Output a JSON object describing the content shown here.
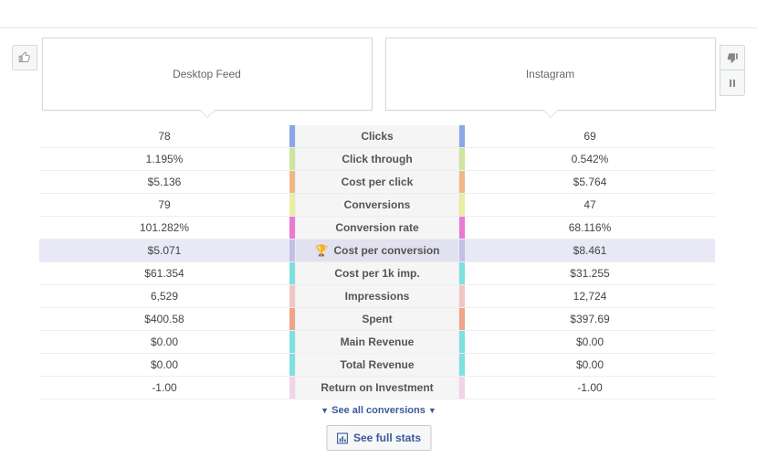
{
  "panels": {
    "left": "Desktop Feed",
    "right": "Instagram"
  },
  "rows": [
    {
      "label": "Clicks",
      "left": "78",
      "right": "69",
      "colorL": "#8aa6e6",
      "colorR": "#8aa6e6"
    },
    {
      "label": "Click through",
      "left": "1.195%",
      "right": "0.542%",
      "colorL": "#cde59c",
      "colorR": "#cde59c"
    },
    {
      "label": "Cost per click",
      "left": "$5.136",
      "right": "$5.764",
      "colorL": "#f0b785",
      "colorR": "#f0b785"
    },
    {
      "label": "Conversions",
      "left": "79",
      "right": "47",
      "colorL": "#e6f0a0",
      "colorR": "#e6f0a0"
    },
    {
      "label": "Conversion rate",
      "left": "101.282%",
      "right": "68.116%",
      "colorL": "#e87ad1",
      "colorR": "#e87ad1"
    },
    {
      "label": "Cost per conversion",
      "left": "$5.071",
      "right": "$8.461",
      "colorL": "#c3bfe6",
      "colorR": "#c3bfe6",
      "highlight": true,
      "trophy": true
    },
    {
      "label": "Cost per 1k imp.",
      "left": "$61.354",
      "right": "$31.255",
      "colorL": "#7de0e0",
      "colorR": "#7de0e0"
    },
    {
      "label": "Impressions",
      "left": "6,529",
      "right": "12,724",
      "colorL": "#f2c5c5",
      "colorR": "#f2c5c5"
    },
    {
      "label": "Spent",
      "left": "$400.58",
      "right": "$397.69",
      "colorL": "#f0a488",
      "colorR": "#f0a488"
    },
    {
      "label": "Main Revenue",
      "left": "$0.00",
      "right": "$0.00",
      "colorL": "#7ee0e0",
      "colorR": "#7ee0e0"
    },
    {
      "label": "Total Revenue",
      "left": "$0.00",
      "right": "$0.00",
      "colorL": "#7ee0e0",
      "colorR": "#7ee0e0"
    },
    {
      "label": "Return on Investment",
      "left": "-1.00",
      "right": "-1.00",
      "colorL": "#f2d4e6",
      "colorR": "#f2d4e6"
    }
  ],
  "links": {
    "see_all": "See all conversions",
    "full_stats": "See full stats"
  }
}
